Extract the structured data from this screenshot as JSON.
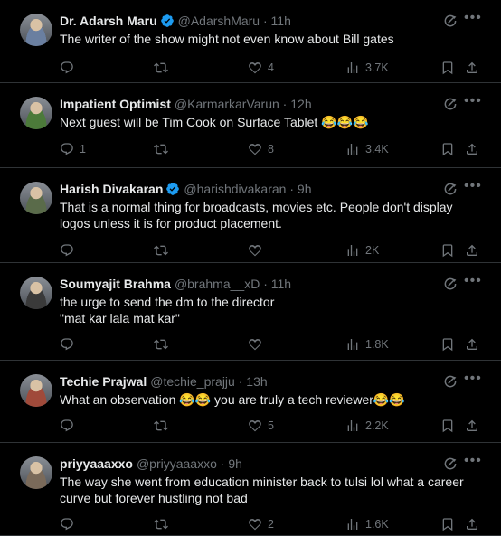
{
  "tweets": [
    {
      "name": "Dr. Adarsh Maru",
      "verified": true,
      "handle": "@AdarshMaru",
      "time": "11h",
      "lines": [
        "The writer of the show might not even know about Bill gates"
      ],
      "replies": "",
      "retweets": "",
      "likes": "4",
      "views": "3.7K",
      "avatar_color": "#6a7fa0",
      "avatar_icon": "person-avatar"
    },
    {
      "name": "Impatient Optimist",
      "verified": false,
      "handle": "@KarmarkarVarun",
      "time": "12h",
      "lines": [
        "Next guest will be Tim Cook on Surface Tablet 😂😂😂"
      ],
      "replies": "1",
      "retweets": "",
      "likes": "8",
      "views": "3.4K",
      "avatar_color": "#4c7a3a",
      "avatar_icon": "landscape-avatar"
    },
    {
      "name": "Harish Divakaran",
      "verified": true,
      "handle": "@harishdivakaran",
      "time": "9h",
      "lines": [
        "That is a normal thing for broadcasts, movies etc. People don't display",
        "logos unless it is for product placement."
      ],
      "replies": "",
      "retweets": "",
      "likes": "",
      "views": "2K",
      "avatar_color": "#5a6b4a",
      "avatar_icon": "group-avatar"
    },
    {
      "name": "Soumyajit Brahma",
      "verified": false,
      "handle": "@brahma__xD",
      "time": "11h",
      "lines": [
        "the urge to send the dm to the director",
        "\"mat kar lala mat kar\""
      ],
      "replies": "",
      "retweets": "",
      "likes": "",
      "views": "1.8K",
      "avatar_color": "#3a3a3a",
      "avatar_icon": "person-avatar"
    },
    {
      "name": "Techie Prajwal",
      "verified": false,
      "handle": "@techie_prajju",
      "time": "13h",
      "lines": [
        "What an observation 😂😂 you are truly a tech reviewer😂😂"
      ],
      "replies": "",
      "retweets": "",
      "likes": "5",
      "views": "2.2K",
      "avatar_color": "#a04a3a",
      "avatar_icon": "person-avatar"
    },
    {
      "name": "priyyaaaxxo",
      "verified": false,
      "handle": "@priyyaaaxxo",
      "time": "9h",
      "lines": [
        "The way she went from education minister back to tulsi lol what a career",
        "curve but forever hustling not bad"
      ],
      "replies": "",
      "retweets": "",
      "likes": "2",
      "views": "1.6K",
      "avatar_color": "#7a6a5a",
      "avatar_icon": "person-avatar"
    }
  ],
  "colors": {
    "background": "#000000",
    "text": "#e7e9ea",
    "muted": "#71767b",
    "verified": "#1d9bf0",
    "divider": "#2f3336"
  }
}
